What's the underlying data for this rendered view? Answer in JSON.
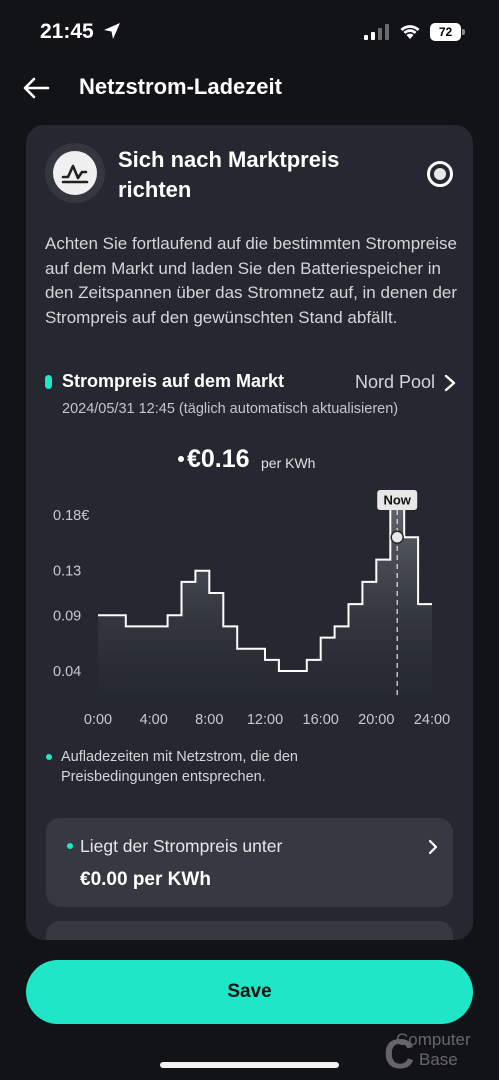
{
  "status_bar": {
    "time": "21:45",
    "battery": "72"
  },
  "header": {
    "title": "Netzstrom-Ladezeit"
  },
  "option": {
    "title": "Sich nach Marktpreis richten",
    "description": "Achten Sie fortlaufend auf die bestimmten Strompreise auf dem Markt und laden Sie den Batteriespeicher in den Zeitspannen über das Stromnetz auf, in denen der Strompreis auf den gewünschten Stand abfällt.",
    "icon": "market-price-icon",
    "selected": true
  },
  "market": {
    "title": "Strompreis auf dem Markt",
    "source": "Nord Pool",
    "updated": "2024/05/31 12:45 (täglich automatisch aktualisieren)"
  },
  "current_price": {
    "value": "€0.16",
    "unit": "per KWh"
  },
  "chart_data": {
    "type": "line",
    "step": true,
    "y_tick_labels": [
      "0.18€",
      "0.13",
      "0.09",
      "0.04"
    ],
    "y_ticks": [
      0.18,
      0.13,
      0.09,
      0.04
    ],
    "x_tick_labels": [
      "0:00",
      "4:00",
      "8:00",
      "12:00",
      "16:00",
      "20:00",
      "24:00"
    ],
    "x_ticks": [
      0,
      4,
      8,
      12,
      16,
      20,
      24
    ],
    "ylim": [
      0.04,
      0.18
    ],
    "xlim": [
      0,
      24
    ],
    "series": [
      {
        "x": [
          0,
          1,
          2,
          3,
          4,
          5,
          6,
          7,
          8,
          9,
          10,
          11,
          12,
          13,
          14,
          15,
          16,
          17,
          18,
          19,
          20,
          21,
          22,
          23
        ],
        "values": [
          0.09,
          0.09,
          0.08,
          0.08,
          0.08,
          0.09,
          0.12,
          0.13,
          0.11,
          0.08,
          0.06,
          0.06,
          0.05,
          0.04,
          0.04,
          0.05,
          0.07,
          0.08,
          0.1,
          0.12,
          0.14,
          0.19,
          0.16,
          0.1
        ]
      }
    ],
    "now_label": "Now",
    "now_hour": 21.5,
    "now_value": 0.16,
    "line_color": "#ffffff"
  },
  "legend": {
    "text": "Aufladezeiten mit Netzstrom, die den Preisbedingungen entsprechen."
  },
  "condition": {
    "label": "Liegt der Strompreis unter",
    "value": "€0.00 per KWh"
  },
  "save_button": {
    "label": "Save"
  },
  "colors": {
    "accent": "#1ee6c6",
    "background": "#121317",
    "card": "#252830",
    "subcard": "#363942"
  },
  "watermark": {
    "line1": "Computer",
    "line2": "Base"
  }
}
